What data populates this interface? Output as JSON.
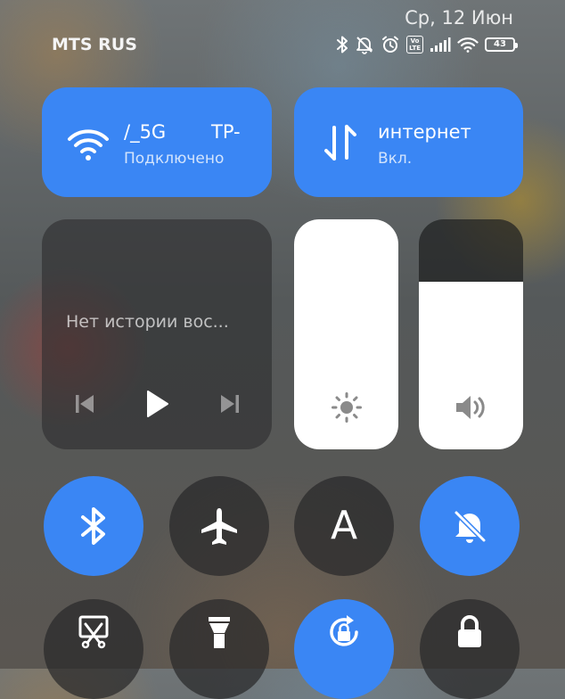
{
  "status_bar": {
    "datetime": "Ср, 12 Июн",
    "carrier": "MTS RUS",
    "volte_top": "Vo",
    "volte_bottom": "LTE",
    "battery": "43",
    "icons": [
      "bluetooth-icon",
      "mute-icon",
      "alarm-icon",
      "volte-icon",
      "cell-signal-icon",
      "wifi-icon",
      "battery-icon"
    ]
  },
  "wifi_tile": {
    "ssid_part1": "/_5G",
    "ssid_part2": "TP-",
    "status": "Подключено",
    "icon": "wifi-icon",
    "active": true
  },
  "data_tile": {
    "title": "интернет",
    "status": "Вкл.",
    "icon": "mobile-data-icon",
    "active": true
  },
  "media": {
    "title": "Нет истории вос...",
    "controls": [
      "previous-icon",
      "play-icon",
      "next-icon"
    ]
  },
  "sliders": {
    "brightness_level": 1.0,
    "volume_level": 0.73,
    "brightness_icon": "brightness-icon",
    "volume_icon": "volume-icon"
  },
  "toggles": [
    {
      "name": "bluetooth",
      "icon": "bluetooth-icon",
      "active": true
    },
    {
      "name": "airplane",
      "icon": "airplane-icon",
      "active": false
    },
    {
      "name": "auto-brightness",
      "icon": "auto-brightness-icon",
      "label": "A",
      "active": false
    },
    {
      "name": "mute",
      "icon": "mute-icon",
      "active": true
    },
    {
      "name": "screenshot",
      "icon": "screenshot-icon",
      "active": false
    },
    {
      "name": "flashlight",
      "icon": "flashlight-icon",
      "active": false
    },
    {
      "name": "rotation-lock",
      "icon": "rotation-lock-icon",
      "active": true
    },
    {
      "name": "lock-screen",
      "icon": "lock-icon",
      "active": false
    }
  ],
  "colors": {
    "accent": "#3a86f4",
    "tile_inactive": "#2a2a2c",
    "slider_fill": "#ffffff"
  }
}
